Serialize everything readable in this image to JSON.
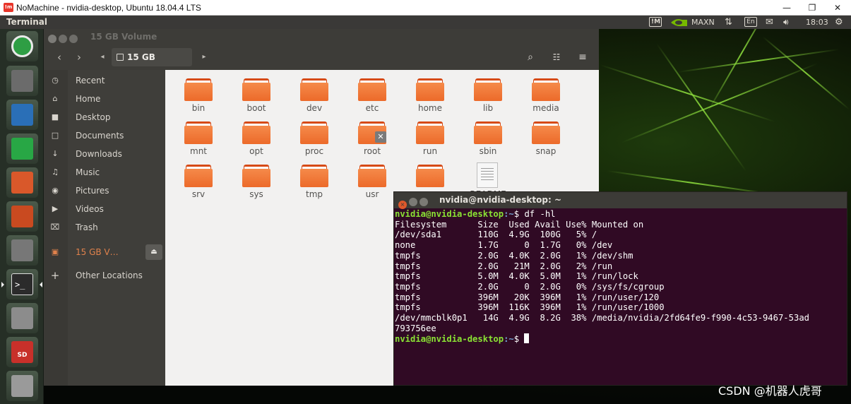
{
  "nomachine": {
    "logo": "!m",
    "title": "NoMachine - nvidia-desktop, Ubuntu 18.04.4 LTS",
    "minimize": "—",
    "restore": "❐",
    "close": "✕"
  },
  "panel": {
    "app_title": "Terminal",
    "indicators": {
      "mode": "MAXN",
      "keyboard": "En",
      "clock": "18:03"
    }
  },
  "launcher": {
    "items": [
      {
        "name": "ubuntu-dash",
        "color": "#2e9e44"
      },
      {
        "name": "files",
        "color": "#6b6b6b"
      },
      {
        "name": "libreoffice-writer",
        "color": "#2a6fb7"
      },
      {
        "name": "libreoffice-calc",
        "color": "#28a745"
      },
      {
        "name": "libreoffice-impress",
        "color": "#d9582a"
      },
      {
        "name": "software-center",
        "color": "#c94a20"
      },
      {
        "name": "system-settings",
        "color": "#777777"
      },
      {
        "name": "terminal",
        "color": "#2b2b2b"
      },
      {
        "name": "drive",
        "color": "#8c8c8c"
      },
      {
        "name": "sd-card",
        "color": "#c8302a"
      },
      {
        "name": "disk",
        "color": "#9a9a9a"
      }
    ],
    "sd_label": "SD"
  },
  "files": {
    "window_title": "15 GB Volume",
    "path_button": "15 GB Volume",
    "sidebar": [
      {
        "icon": "clock-icon",
        "glyph": "◷",
        "label": "Recent"
      },
      {
        "icon": "home-icon",
        "glyph": "⌂",
        "label": "Home"
      },
      {
        "icon": "desktop-icon",
        "glyph": "■",
        "label": "Desktop"
      },
      {
        "icon": "documents-icon",
        "glyph": "□",
        "label": "Documents"
      },
      {
        "icon": "downloads-icon",
        "glyph": "↓",
        "label": "Downloads"
      },
      {
        "icon": "music-icon",
        "glyph": "♫",
        "label": "Music"
      },
      {
        "icon": "pictures-icon",
        "glyph": "◉",
        "label": "Pictures"
      },
      {
        "icon": "videos-icon",
        "glyph": "▶",
        "label": "Videos"
      },
      {
        "icon": "trash-icon",
        "glyph": "⌧",
        "label": "Trash"
      }
    ],
    "volume_item": {
      "label": "15 GB V…",
      "eject": "⏏"
    },
    "other_locations": {
      "glyph": "+",
      "label": "Other Locations"
    },
    "items": [
      {
        "name": "bin"
      },
      {
        "name": "boot"
      },
      {
        "name": "dev"
      },
      {
        "name": "etc"
      },
      {
        "name": "home"
      },
      {
        "name": "lib"
      },
      {
        "name": "media"
      },
      {
        "name": "mnt"
      },
      {
        "name": "opt"
      },
      {
        "name": "proc"
      },
      {
        "name": "root",
        "locked": true
      },
      {
        "name": "run"
      },
      {
        "name": "sbin"
      },
      {
        "name": "snap"
      },
      {
        "name": "srv"
      },
      {
        "name": "sys"
      },
      {
        "name": "tmp"
      },
      {
        "name": "usr"
      },
      {
        "name": ""
      },
      {
        "name": "README",
        "type": "document"
      }
    ]
  },
  "terminal": {
    "title": "nvidia@nvidia-desktop: ~",
    "prompt_user": "nvidia@nvidia-desktop",
    "prompt_path": ":~",
    "prompt_symbol": "$ ",
    "command": "df -hl",
    "output": [
      "Filesystem      Size  Used Avail Use% Mounted on",
      "/dev/sda1       110G  4.9G  100G   5% /",
      "none            1.7G     0  1.7G   0% /dev",
      "tmpfs           2.0G  4.0K  2.0G   1% /dev/shm",
      "tmpfs           2.0G   21M  2.0G   2% /run",
      "tmpfs           5.0M  4.0K  5.0M   1% /run/lock",
      "tmpfs           2.0G     0  2.0G   0% /sys/fs/cgroup",
      "tmpfs           396M   20K  396M   1% /run/user/120",
      "tmpfs           396M  116K  396M   1% /run/user/1000",
      "/dev/mmcblk0p1   14G  4.9G  8.2G  38% /media/nvidia/2fd64fe9-f990-4c53-9467-53ad",
      "793756ee"
    ]
  },
  "watermark": "CSDN @机器人虎哥"
}
